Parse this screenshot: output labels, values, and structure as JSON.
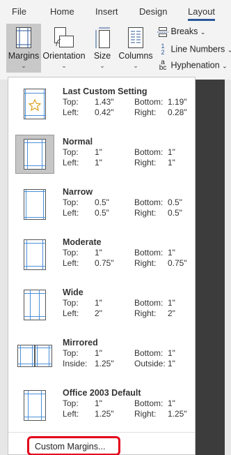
{
  "tabs": [
    "File",
    "Home",
    "Insert",
    "Design",
    "Layout"
  ],
  "ribbon": {
    "margins_label": "Margins",
    "orientation_label": "Orientation",
    "size_label": "Size",
    "columns_label": "Columns",
    "breaks_label": "Breaks",
    "line_numbers_label": "Line Numbers",
    "hyphenation_label": "Hyphenation"
  },
  "margin_options": [
    {
      "name": "Last Custom Setting",
      "l1": "Top:",
      "v1": "1.43\"",
      "l2": "Bottom:",
      "v2": "1.19\"",
      "l3": "Left:",
      "v3": "0.42\"",
      "l4": "Right:",
      "v4": "0.28\""
    },
    {
      "name": "Normal",
      "l1": "Top:",
      "v1": "1\"",
      "l2": "Bottom:",
      "v2": "1\"",
      "l3": "Left:",
      "v3": "1\"",
      "l4": "Right:",
      "v4": "1\""
    },
    {
      "name": "Narrow",
      "l1": "Top:",
      "v1": "0.5\"",
      "l2": "Bottom:",
      "v2": "0.5\"",
      "l3": "Left:",
      "v3": "0.5\"",
      "l4": "Right:",
      "v4": "0.5\""
    },
    {
      "name": "Moderate",
      "l1": "Top:",
      "v1": "1\"",
      "l2": "Bottom:",
      "v2": "1\"",
      "l3": "Left:",
      "v3": "0.75\"",
      "l4": "Right:",
      "v4": "0.75\""
    },
    {
      "name": "Wide",
      "l1": "Top:",
      "v1": "1\"",
      "l2": "Bottom:",
      "v2": "1\"",
      "l3": "Left:",
      "v3": "2\"",
      "l4": "Right:",
      "v4": "2\""
    },
    {
      "name": "Mirrored",
      "l1": "Top:",
      "v1": "1\"",
      "l2": "Bottom:",
      "v2": "1\"",
      "l3": "Inside:",
      "v3": "1.25\"",
      "l4": "Outside:",
      "v4": "1\""
    },
    {
      "name": "Office 2003 Default",
      "l1": "Top:",
      "v1": "1\"",
      "l2": "Bottom:",
      "v2": "1\"",
      "l3": "Left:",
      "v3": "1.25\"",
      "l4": "Right:",
      "v4": "1.25\""
    }
  ],
  "custom_margins_label": "Custom Margins...",
  "colors": {
    "accent": "#2b579a",
    "highlight": "#e2001a",
    "guide": "#4a90d9"
  }
}
